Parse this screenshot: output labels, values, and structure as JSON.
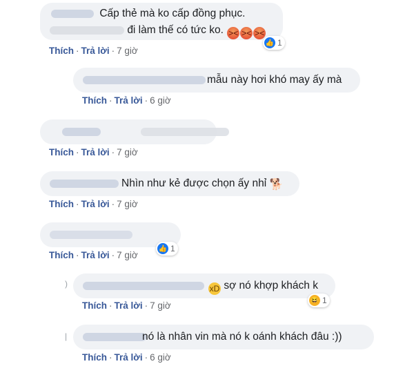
{
  "actions": {
    "like": "Thích",
    "reply": "Trả lời",
    "separator": "·"
  },
  "comments": [
    {
      "line1": "Cấp thẻ mà ko cấp đồng phục.",
      "line2": "đi làm thế có tức ko.",
      "emoji": "angry-face-x3",
      "time": "7 giờ",
      "reaction": {
        "icon": "like-icon",
        "count": "1"
      }
    },
    {
      "text": "mẫu này hơi khó may ấy mà",
      "time": "6 giờ"
    },
    {
      "text": "",
      "time": "7 giờ"
    },
    {
      "text": "Nhìn như kẻ được chọn ấy nhỉ",
      "emoji": "dog-icon",
      "time": "7 giờ"
    },
    {
      "text": "",
      "time": "7 giờ",
      "reaction": {
        "icon": "like-icon",
        "count": "1"
      }
    },
    {
      "text": "sợ nó khợp khách k",
      "emoji": "laughing-face",
      "time": "7 giờ",
      "reaction": {
        "icon": "haha-icon",
        "count": "1"
      }
    },
    {
      "text": "nó là nhân vin mà nó k oánh khách đâu :))",
      "time": "6 giờ"
    }
  ]
}
